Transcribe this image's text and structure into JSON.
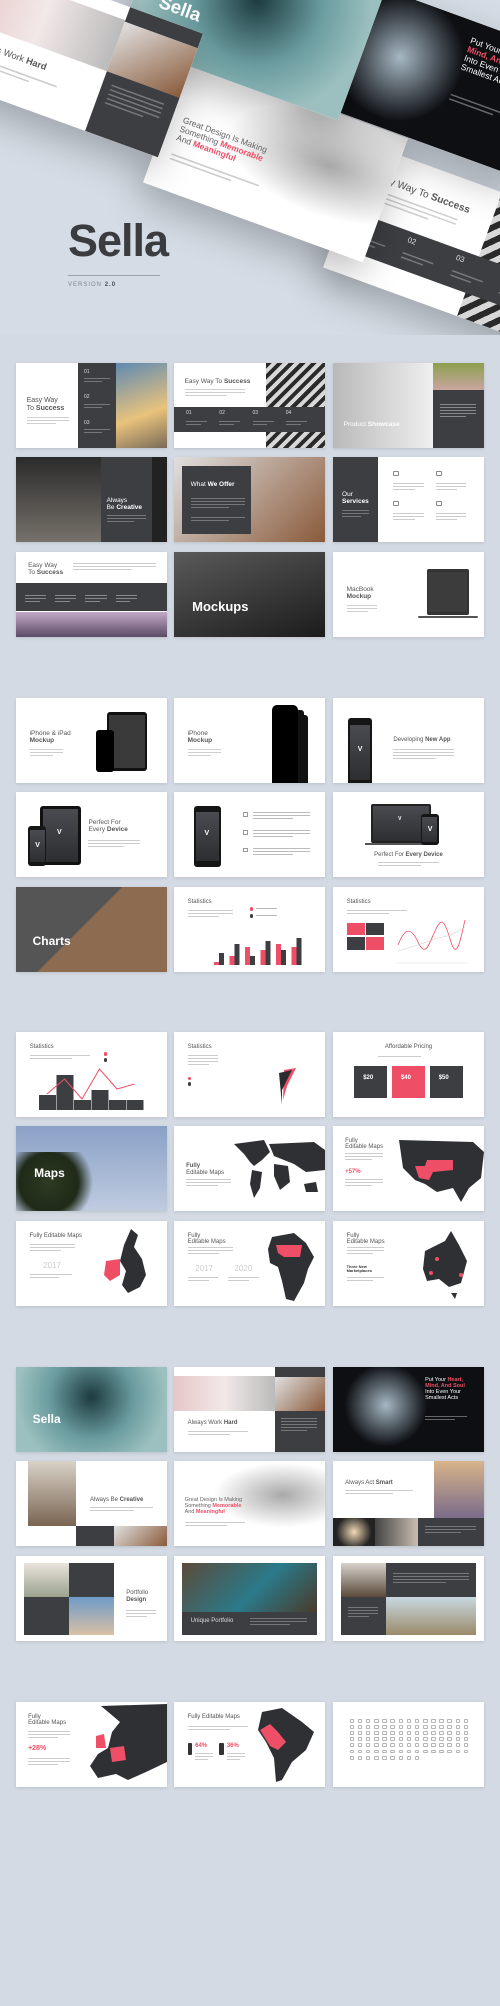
{
  "brand": {
    "name": "Sella",
    "version_label": "VERSION",
    "version": "2.0"
  },
  "colors": {
    "dark": "#3d3e42",
    "accent": "#ef4f66",
    "background": "#d3dae3"
  },
  "sections": [
    {
      "slides": [
        {
          "title": [
            [
              {
                "text": "Easy Way"
              }
            ],
            [
              {
                "text": "To "
              },
              {
                "text": "Success",
                "em": "bold"
              }
            ]
          ],
          "labels": [
            "01",
            "02",
            "03"
          ]
        },
        {
          "title": [
            [
              {
                "text": "Easy Way To "
              },
              {
                "text": "Success",
                "em": "bold"
              }
            ]
          ],
          "labels": [
            "01",
            "02",
            "03",
            "04"
          ]
        },
        {
          "title": [
            [
              {
                "text": "Product "
              },
              {
                "text": "Showcase",
                "em": "bold"
              }
            ]
          ]
        },
        {
          "title": [
            [
              {
                "text": "Always"
              }
            ],
            [
              {
                "text": "Be "
              },
              {
                "text": "Creative",
                "em": "bold"
              }
            ]
          ]
        },
        {
          "title": [
            [
              {
                "text": "What "
              },
              {
                "text": "We Offer",
                "em": "bold"
              }
            ]
          ]
        },
        {
          "title": [
            [
              {
                "text": "Our"
              }
            ],
            [
              {
                "text": "Services",
                "em": "bold"
              }
            ]
          ]
        },
        {
          "title": [
            [
              {
                "text": "Easy Way"
              }
            ],
            [
              {
                "text": "To "
              },
              {
                "text": "Success",
                "em": "bold"
              }
            ]
          ]
        },
        {
          "title": [
            [
              {
                "text": "Mockups",
                "em": "bold"
              }
            ]
          ]
        },
        {
          "title": [
            [
              {
                "text": "MacBook"
              }
            ],
            [
              {
                "text": "Mockup",
                "em": "bold"
              }
            ]
          ]
        }
      ]
    },
    {
      "slides": [
        {
          "title": [
            [
              {
                "text": "iPhone & iPad"
              }
            ],
            [
              {
                "text": "Mockup",
                "em": "bold"
              }
            ]
          ]
        },
        {
          "title": [
            [
              {
                "text": "iPhone"
              }
            ],
            [
              {
                "text": "Mockup",
                "em": "bold"
              }
            ]
          ]
        },
        {
          "title": [
            [
              {
                "text": "Developing "
              },
              {
                "text": "New App",
                "em": "bold"
              }
            ]
          ],
          "labels": [
            "V"
          ]
        },
        {
          "title": [
            [
              {
                "text": "Perfect For"
              }
            ],
            [
              {
                "text": "Every "
              },
              {
                "text": "Device",
                "em": "bold"
              }
            ]
          ],
          "labels": [
            "V",
            "V"
          ]
        },
        {
          "title": [],
          "labels": [
            "V"
          ]
        },
        {
          "title": [
            [
              {
                "text": "Perfect For "
              },
              {
                "text": "Every Device",
                "em": "bold"
              }
            ]
          ],
          "labels": [
            "V",
            "V"
          ]
        },
        {
          "title": [
            [
              {
                "text": "Charts",
                "em": "bold"
              }
            ]
          ]
        },
        {
          "title": [
            [
              {
                "text": "Statistics"
              }
            ]
          ],
          "bars": [
            [
              1,
              4
            ],
            [
              3,
              7
            ],
            [
              6,
              3
            ],
            [
              5,
              8
            ],
            [
              7,
              5
            ],
            [
              6,
              9
            ]
          ]
        },
        {
          "title": [
            [
              {
                "text": "Statistics"
              }
            ]
          ]
        }
      ]
    },
    {
      "slides": [
        {
          "title": [
            [
              {
                "text": "Statistics"
              }
            ]
          ],
          "bars": [
            3,
            7,
            2,
            4,
            2,
            2
          ],
          "line": [
            2,
            5,
            1,
            7,
            3,
            4
          ]
        },
        {
          "title": [
            [
              {
                "text": "Statistics"
              }
            ]
          ]
        },
        {
          "title": [
            [
              {
                "text": "Affordable Pricing"
              }
            ]
          ],
          "labels": [
            "$20",
            "$40",
            "$50"
          ]
        },
        {
          "title": [
            [
              {
                "text": "Maps",
                "em": "bold"
              }
            ]
          ]
        },
        {
          "title": [
            [
              {
                "text": "Fully",
                "em": "bold"
              }
            ],
            [
              {
                "text": "Editable Maps"
              }
            ]
          ]
        },
        {
          "title": [
            [
              {
                "text": "Fully"
              }
            ],
            [
              {
                "text": "Editable Maps"
              }
            ]
          ],
          "labels": [
            "+57%"
          ]
        },
        {
          "title": [
            [
              {
                "text": "Fully Editable Maps"
              }
            ]
          ],
          "labels": [
            "2017"
          ]
        },
        {
          "title": [
            [
              {
                "text": "Fully"
              }
            ],
            [
              {
                "text": "Editable Maps"
              }
            ]
          ],
          "labels": [
            "2017",
            "2020"
          ]
        },
        {
          "title": [
            [
              {
                "text": "Fully"
              }
            ],
            [
              {
                "text": "Editable Maps"
              }
            ]
          ],
          "labels": [
            "Three New",
            "Marketplaces"
          ]
        }
      ]
    },
    {
      "slides": [
        {
          "title": [
            [
              {
                "text": "Sella",
                "em": "bold"
              }
            ]
          ]
        },
        {
          "title": [
            [
              {
                "text": "Always Work "
              },
              {
                "text": "Hard",
                "em": "bold"
              }
            ]
          ]
        },
        {
          "title": [
            [
              {
                "text": "Put Your "
              },
              {
                "text": "Heart,",
                "em": "accent"
              }
            ],
            [
              {
                "text": "Mind, And Soul",
                "em": "accent"
              }
            ],
            [
              {
                "text": "Into Even Your"
              }
            ],
            [
              {
                "text": "Smallest Acts"
              }
            ]
          ]
        },
        {
          "title": [
            [
              {
                "text": "Always Be "
              },
              {
                "text": "Creative",
                "em": "bold"
              }
            ]
          ]
        },
        {
          "title": [
            [
              {
                "text": "Great Design Is Making"
              }
            ],
            [
              {
                "text": "Something "
              },
              {
                "text": "Memorable",
                "em": "accent"
              }
            ],
            [
              {
                "text": "And "
              },
              {
                "text": "Meaningful",
                "em": "accent"
              }
            ]
          ]
        },
        {
          "title": [
            [
              {
                "text": "Always Act "
              },
              {
                "text": "Smart",
                "em": "bold"
              }
            ]
          ]
        },
        {
          "title": [
            [
              {
                "text": "Portfolio"
              }
            ],
            [
              {
                "text": "Design",
                "em": "bold"
              }
            ]
          ]
        },
        {
          "title": [
            [
              {
                "text": "Unique Portfolio"
              }
            ]
          ]
        },
        {
          "title": []
        }
      ]
    },
    {
      "slides": [
        {
          "title": [
            [
              {
                "text": "Fully"
              }
            ],
            [
              {
                "text": "Editable Maps"
              }
            ]
          ],
          "labels": [
            "+28%"
          ]
        },
        {
          "title": [
            [
              {
                "text": "Fully Editable Maps"
              }
            ]
          ],
          "labels": [
            "64%",
            "36%"
          ]
        },
        {
          "title": []
        }
      ]
    }
  ]
}
